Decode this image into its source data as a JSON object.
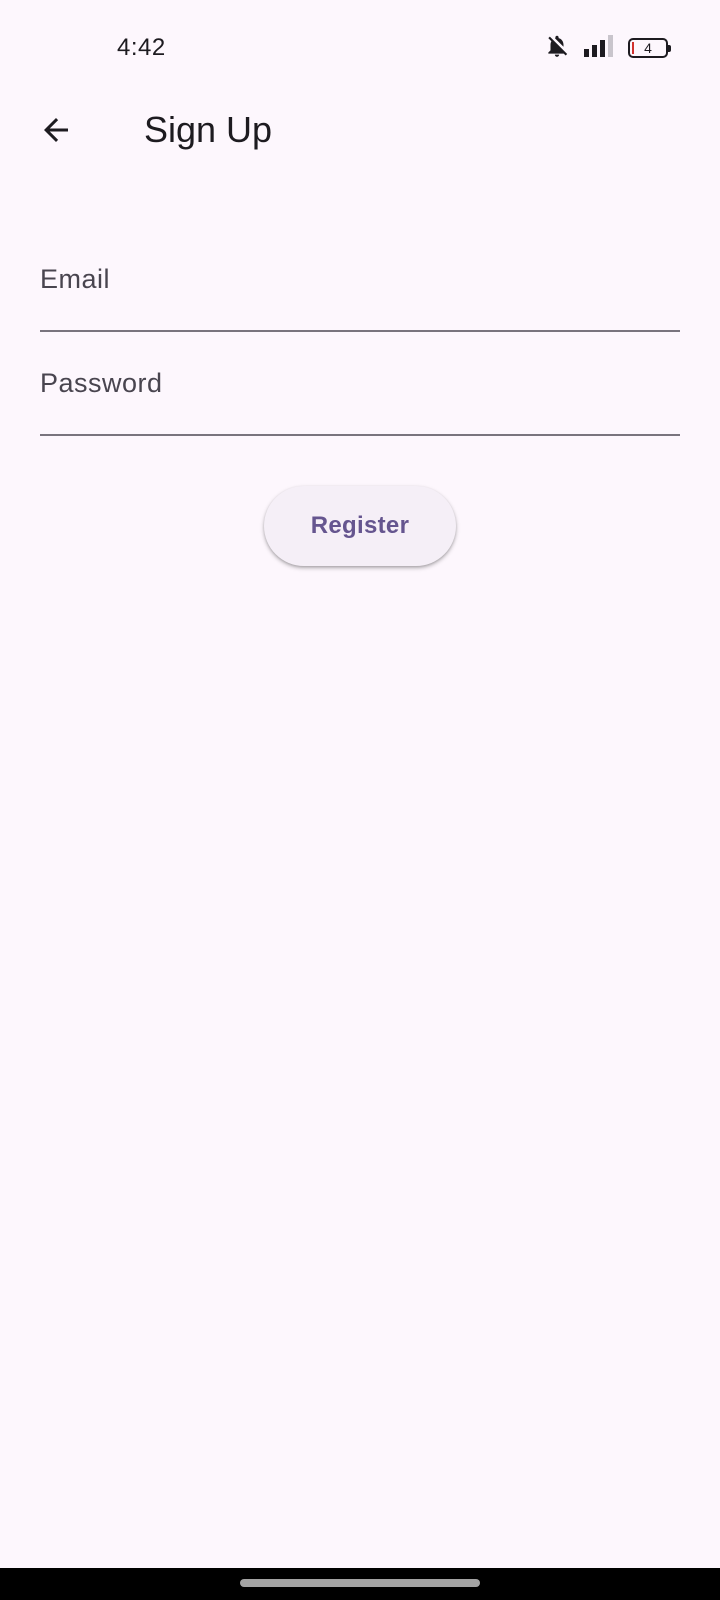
{
  "status_bar": {
    "time": "4:42",
    "battery_level": "4",
    "icons": [
      "bell-off-icon",
      "signal-icon",
      "battery-icon"
    ]
  },
  "app_bar": {
    "title": "Sign Up",
    "back_icon": "arrow-back-icon"
  },
  "form": {
    "email": {
      "value": "",
      "placeholder": "Email"
    },
    "password": {
      "value": "",
      "placeholder": "Password"
    },
    "register_label": "Register"
  },
  "colors": {
    "background": "#fdf7fd",
    "primary": "#65558f",
    "button_surface": "#f5eff7",
    "divider": "#79747e",
    "on_surface": "#1d1b20"
  }
}
